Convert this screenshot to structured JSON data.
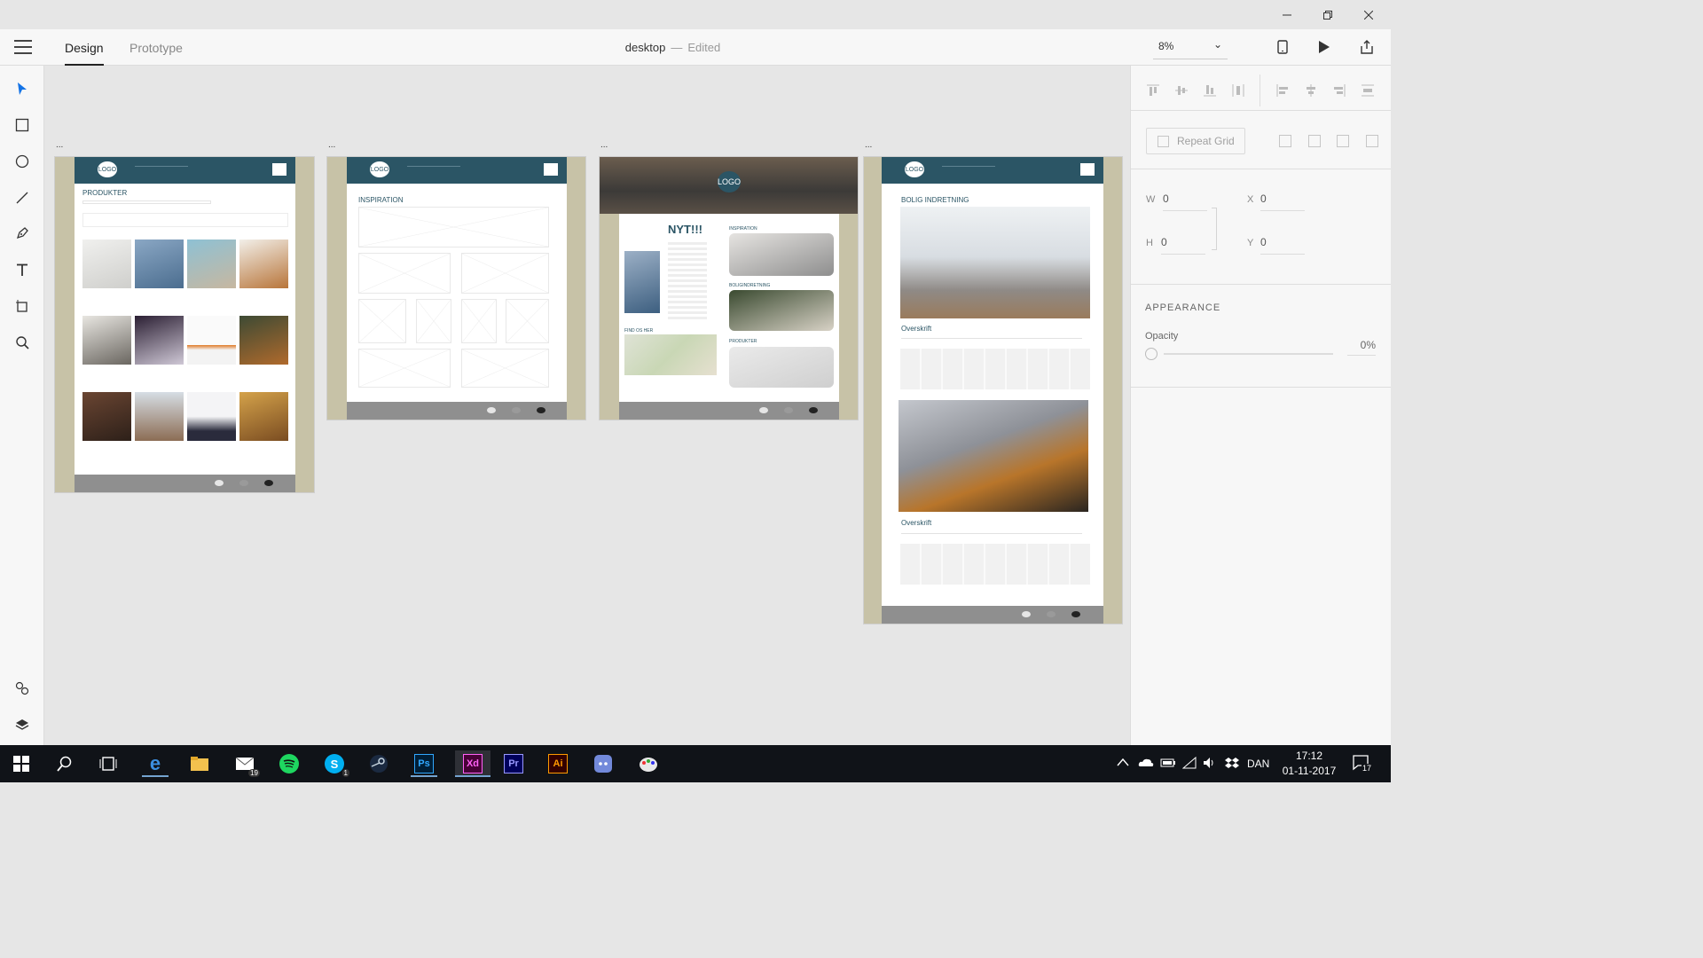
{
  "window": {
    "minimize_icon": "minimize-icon",
    "restore_icon": "restore-icon",
    "close_icon": "close-icon"
  },
  "header": {
    "tabs": [
      {
        "label": "Design",
        "active": true
      },
      {
        "label": "Prototype",
        "active": false
      }
    ],
    "doc_name": "desktop",
    "separator": "—",
    "doc_status": "Edited",
    "zoom": "8%"
  },
  "tools": [
    "select-tool",
    "rectangle-tool",
    "ellipse-tool",
    "line-tool",
    "pen-tool",
    "text-tool",
    "artboard-tool",
    "zoom-tool",
    "symbols-tool",
    "layers-tool"
  ],
  "artboards": [
    {
      "label": "...",
      "logo": "LOGO",
      "section_title": "PRODUKTER"
    },
    {
      "label": "...",
      "logo": "LOGO",
      "section_title": "INSPIRATION"
    },
    {
      "label": "...",
      "logo": "LOGO",
      "headline": "NYT!!!",
      "side_titles": [
        "INSPIRATION",
        "BOLIGINDRETNING",
        "PRODUKTER"
      ],
      "map_title": "FIND OS HER"
    },
    {
      "label": "...",
      "logo": "LOGO",
      "section_title": "BOLIG INDRETNING",
      "subheading_1": "Overskrift",
      "subheading_2": "Overskrift"
    }
  ],
  "properties": {
    "repeat_grid": "Repeat Grid",
    "w_label": "W",
    "w_value": "0",
    "h_label": "H",
    "h_value": "0",
    "x_label": "X",
    "x_value": "0",
    "y_label": "Y",
    "y_value": "0",
    "appearance": "APPEARANCE",
    "opacity_label": "Opacity",
    "opacity_value": "0%"
  },
  "taskbar": {
    "apps": [
      {
        "name": "edge-icon",
        "label": "e"
      },
      {
        "name": "file-explorer-icon",
        "label": ""
      },
      {
        "name": "mail-icon",
        "label": "",
        "badge": "19"
      },
      {
        "name": "spotify-icon",
        "label": ""
      },
      {
        "name": "skype-icon",
        "label": "S",
        "badge": "1"
      },
      {
        "name": "steam-icon",
        "label": ""
      },
      {
        "name": "photoshop-icon",
        "label": "Ps"
      },
      {
        "name": "xd-icon",
        "label": "Xd"
      },
      {
        "name": "premiere-icon",
        "label": "Pr"
      },
      {
        "name": "illustrator-icon",
        "label": "Ai"
      },
      {
        "name": "discord-icon",
        "label": ""
      },
      {
        "name": "paint-icon",
        "label": ""
      }
    ],
    "language": "DAN",
    "time": "17:12",
    "date": "01-11-2017",
    "notification_count": "17"
  },
  "colors": {
    "artboard_header": "#2b5565",
    "artboard_bg": "#c7c2a7",
    "xd_accent": "#ff2bc2",
    "taskbar": "#101318"
  }
}
